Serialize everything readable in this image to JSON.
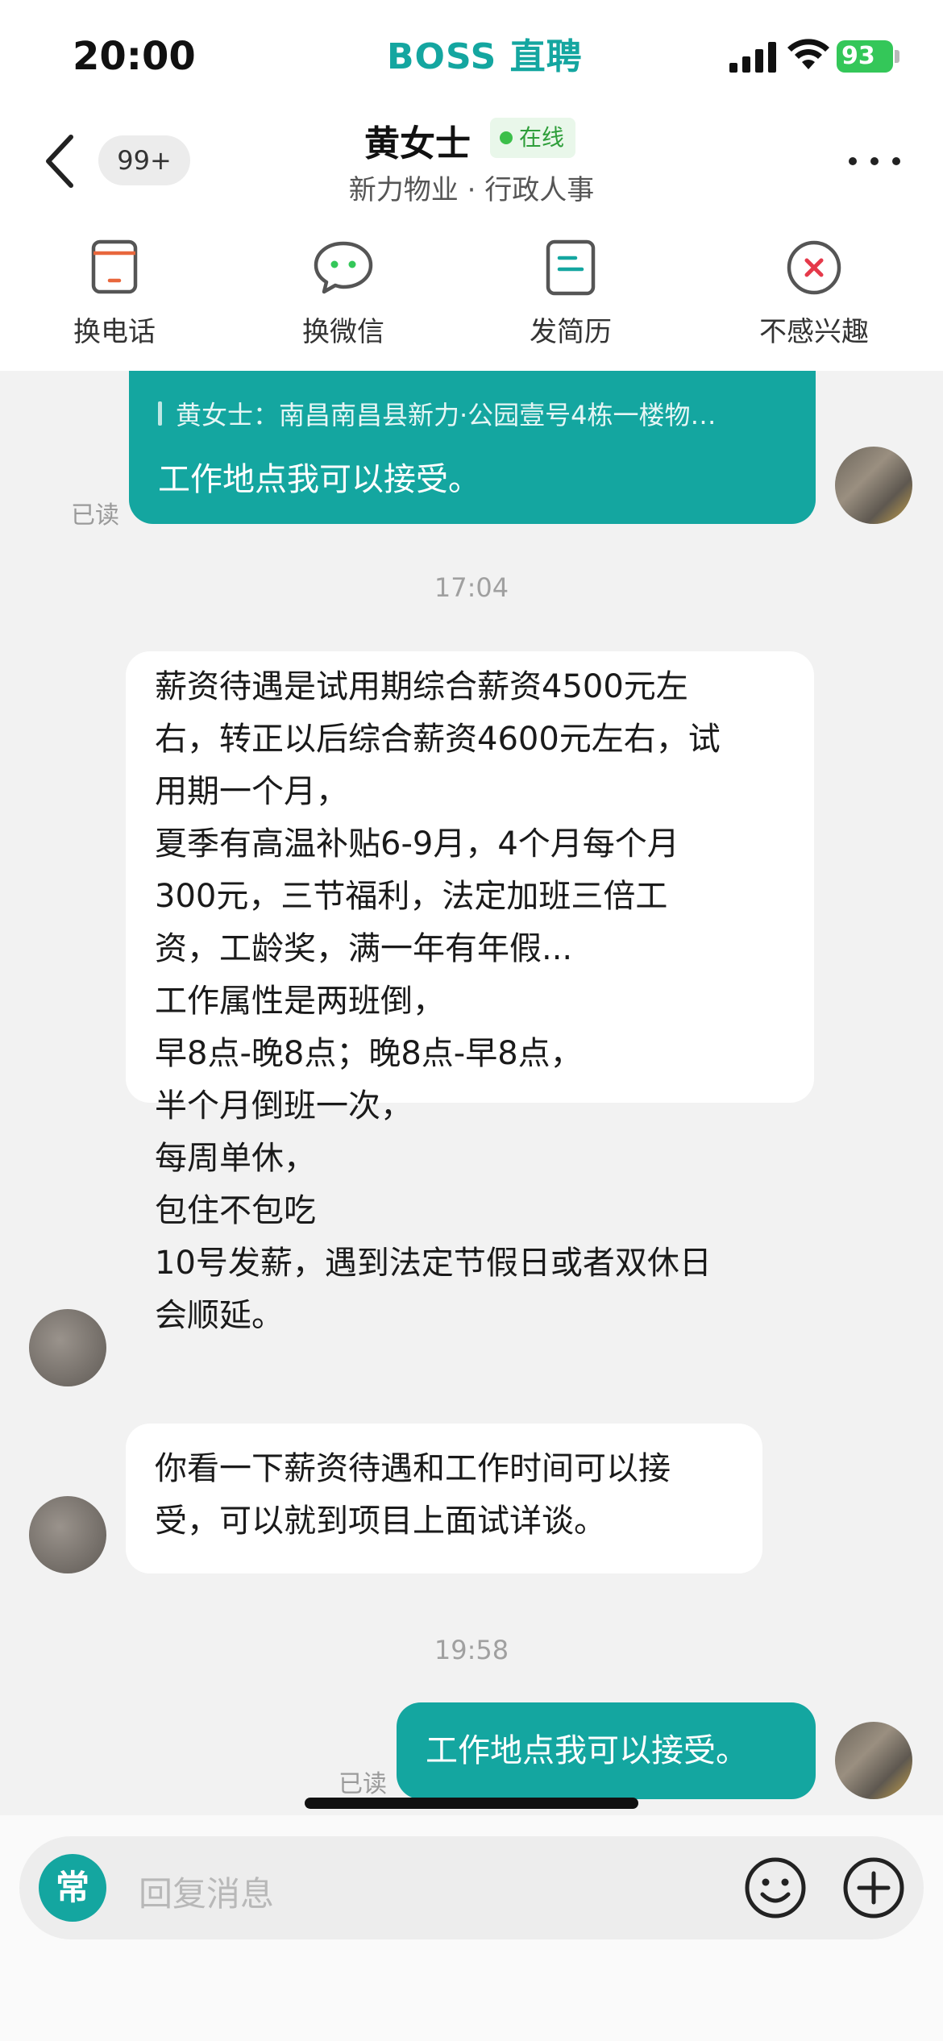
{
  "status_bar": {
    "time": "20:00",
    "brand": "BOSS 直聘",
    "battery": "93"
  },
  "header": {
    "unread_badge": "99+",
    "contact_name": "黄女士",
    "online_status": "在线",
    "subtitle": "新力物业 · 行政人事"
  },
  "actions": [
    {
      "label": "换电话",
      "icon": "phone-card-icon"
    },
    {
      "label": "换微信",
      "icon": "wechat-icon"
    },
    {
      "label": "发简历",
      "icon": "resume-icon"
    },
    {
      "label": "不感兴趣",
      "icon": "not-interested-icon"
    }
  ],
  "messages": {
    "m1_quote": "黄女士：南昌南昌县新力·公园壹号4栋一楼物…",
    "m1_text": "工作地点我可以接受。",
    "m1_read": "已读",
    "time1": "17:04",
    "m2_lines": [
      "薪资待遇是试用期综合薪资4500元左",
      "右，转正以后综合薪资4600元左右，试",
      "用期一个月，",
      "夏季有高温补贴6-9月，4个月每个月",
      "300元，三节福利，法定加班三倍工",
      "资，工龄奖，满一年有年假...",
      "工作属性是两班倒，",
      "早8点-晚8点；晚8点-早8点，",
      "半个月倒班一次，",
      "每周单休，",
      "包住不包吃",
      "10号发薪，遇到法定节假日或者双休日",
      "会顺延。"
    ],
    "m3_lines": [
      "你看一下薪资待遇和工作时间可以接",
      "受，可以就到项目上面试详谈。"
    ],
    "time2": "19:58",
    "m4_text": "工作地点我可以接受。",
    "m4_read": "已读"
  },
  "input": {
    "quick_label": "常",
    "placeholder": "回复消息"
  },
  "colors": {
    "accent": "#14a6a0",
    "online": "#3cbf4a"
  }
}
